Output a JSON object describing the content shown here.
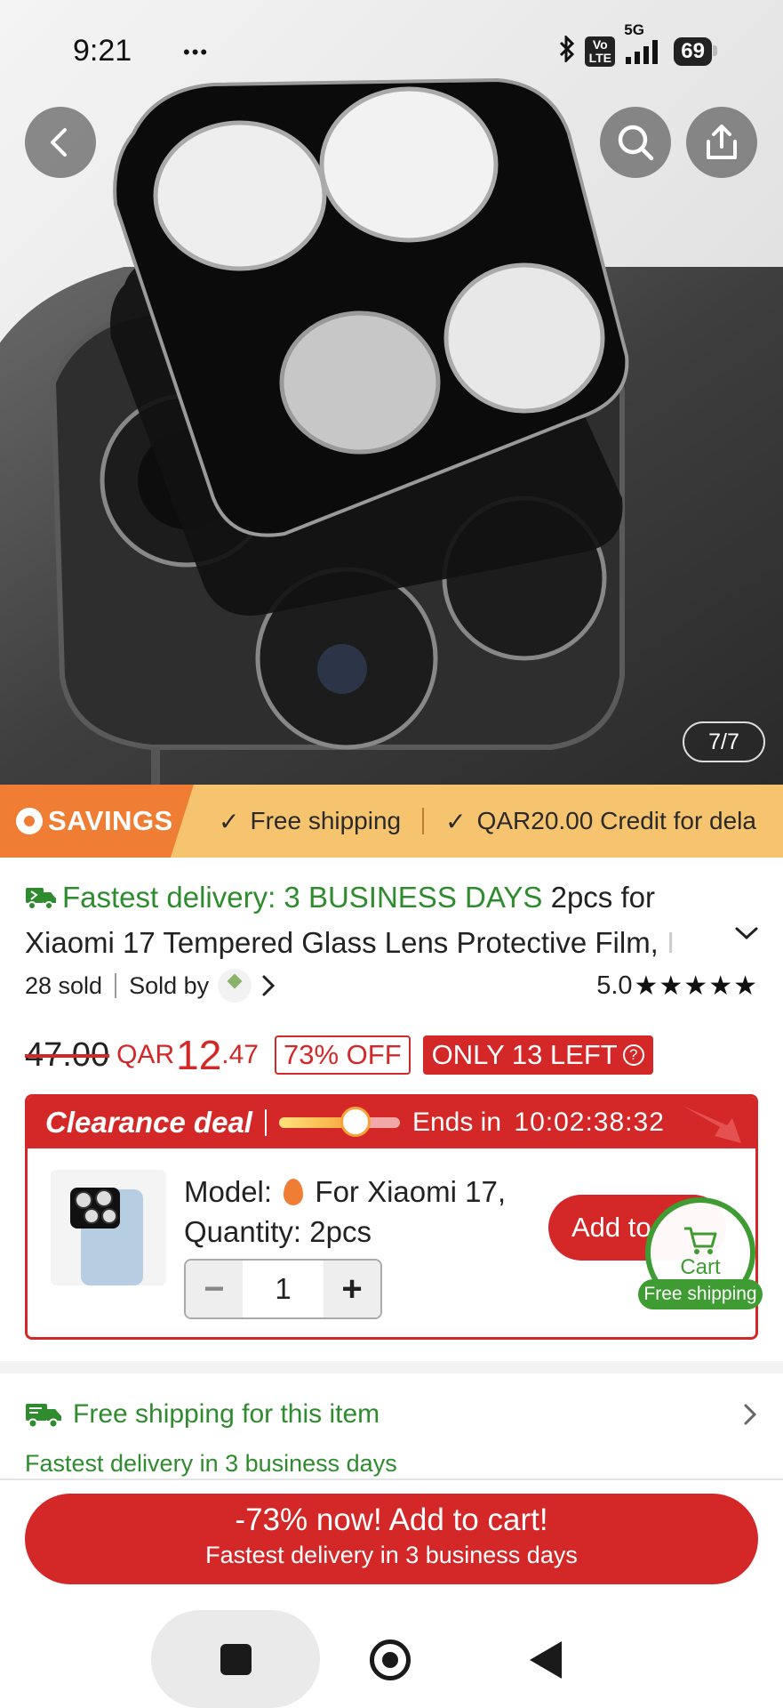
{
  "status_bar": {
    "time": "9:21",
    "extra": "•••",
    "network": "5G",
    "volte": "Vo LTE",
    "battery": "69"
  },
  "gallery": {
    "counter": "7/7"
  },
  "savings_strip": {
    "tag": "SAVINGS",
    "items": [
      "Free shipping",
      "QAR20.00 Credit for dela"
    ]
  },
  "product": {
    "fast_delivery": "Fastest delivery: 3 BUSINESS DAYS",
    "title_line1": "2pcs for",
    "title_line2": "Xiaomi 17 Tempered Glass Lens Protective Film,",
    "title_fade": "I",
    "sold": "28 sold",
    "sold_by": "Sold by",
    "rating": "5.0",
    "stars": "★★★★★"
  },
  "price": {
    "old": "47.00",
    "currency": "QAR",
    "integer": "12",
    "decimal": ".47",
    "discount": "73% OFF",
    "stock": "ONLY 13 LEFT",
    "help": "?"
  },
  "clearance": {
    "title": "Clearance deal",
    "timer_progress": 0.63,
    "ends_label": "Ends in",
    "countdown": "10:02:38:32",
    "model_label": "Model:",
    "model_value": "For Xiaomi 17,",
    "quantity_label": "Quantity: 2pcs",
    "qty": "1",
    "minus": "−",
    "plus": "+",
    "add_label": "Add to"
  },
  "cart": {
    "label": "Cart",
    "badge": "Free shipping"
  },
  "shipping": {
    "label": "Free shipping for this item",
    "note": "Fastest delivery in 3 business days"
  },
  "cta": {
    "main": "-73% now! Add to cart!",
    "sub": "Fastest delivery in 3 business days"
  },
  "colors": {
    "accent_red": "#d42828",
    "green": "#2e8b2e",
    "savings_orange": "#f07d34",
    "savings_bg": "#f6c46f"
  }
}
